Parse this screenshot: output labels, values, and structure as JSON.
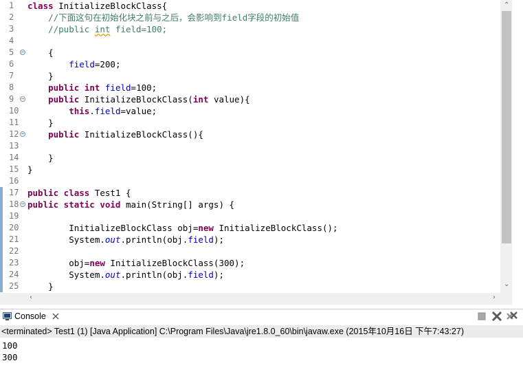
{
  "editor": {
    "lines": [
      {
        "n": "1",
        "code": [
          [
            "kw",
            "class "
          ],
          [
            "pl",
            "InitializeBlockClass{"
          ]
        ]
      },
      {
        "n": "2",
        "code": [
          [
            "pl",
            "    "
          ],
          [
            "cm",
            "//下面这句在初始化块之前与之后，会影响到field字段的初始值"
          ]
        ]
      },
      {
        "n": "3",
        "code": [
          [
            "pl",
            "    "
          ],
          [
            "cm",
            "//public "
          ],
          [
            "cmsq",
            "int"
          ],
          [
            "cm",
            " field=100;"
          ]
        ]
      },
      {
        "n": "4",
        "code": []
      },
      {
        "n": "5",
        "fold": true,
        "code": [
          [
            "pl",
            "    {"
          ]
        ]
      },
      {
        "n": "6",
        "code": [
          [
            "pl",
            "        "
          ],
          [
            "fd",
            "field"
          ],
          [
            "pl",
            "=200;"
          ]
        ]
      },
      {
        "n": "7",
        "code": [
          [
            "pl",
            "    }"
          ]
        ]
      },
      {
        "n": "8",
        "code": [
          [
            "pl",
            "    "
          ],
          [
            "kw",
            "public int "
          ],
          [
            "fd",
            "field"
          ],
          [
            "pl",
            "=100;"
          ]
        ]
      },
      {
        "n": "9",
        "fold": true,
        "code": [
          [
            "pl",
            "    "
          ],
          [
            "kw",
            "public "
          ],
          [
            "pl",
            "InitializeBlockClass("
          ],
          [
            "kw",
            "int "
          ],
          [
            "pl",
            "value){"
          ]
        ]
      },
      {
        "n": "10",
        "code": [
          [
            "pl",
            "        "
          ],
          [
            "kw",
            "this"
          ],
          [
            "pl",
            "."
          ],
          [
            "fd",
            "field"
          ],
          [
            "pl",
            "=value;"
          ]
        ]
      },
      {
        "n": "11",
        "code": [
          [
            "pl",
            "    }"
          ]
        ]
      },
      {
        "n": "12",
        "fold": true,
        "code": [
          [
            "pl",
            "    "
          ],
          [
            "kw",
            "public "
          ],
          [
            "pl",
            "InitializeBlockClass(){"
          ]
        ]
      },
      {
        "n": "13",
        "code": []
      },
      {
        "n": "14",
        "code": [
          [
            "pl",
            "    }"
          ]
        ]
      },
      {
        "n": "15",
        "code": [
          [
            "pl",
            "}"
          ]
        ]
      },
      {
        "n": "16",
        "code": []
      },
      {
        "n": "17",
        "marker": true,
        "code": [
          [
            "kw",
            "public class "
          ],
          [
            "pl",
            "Test1 {"
          ]
        ]
      },
      {
        "n": "18",
        "marker": true,
        "fold": true,
        "code": [
          [
            "kw",
            "public static void "
          ],
          [
            "pl",
            "main(String[] args) {"
          ]
        ]
      },
      {
        "n": "19",
        "marker": true,
        "code": []
      },
      {
        "n": "20",
        "marker": true,
        "code": [
          [
            "pl",
            "        InitializeBlockClass obj="
          ],
          [
            "kw",
            "new "
          ],
          [
            "pl",
            "InitializeBlockClass();"
          ]
        ]
      },
      {
        "n": "21",
        "marker": true,
        "code": [
          [
            "pl",
            "        System."
          ],
          [
            "st",
            "out"
          ],
          [
            "pl",
            ".println(obj."
          ],
          [
            "fd",
            "field"
          ],
          [
            "pl",
            ");"
          ]
        ]
      },
      {
        "n": "22",
        "marker": true,
        "code": []
      },
      {
        "n": "23",
        "marker": true,
        "code": [
          [
            "pl",
            "        obj="
          ],
          [
            "kw",
            "new "
          ],
          [
            "pl",
            "InitializeBlockClass(300);"
          ]
        ]
      },
      {
        "n": "24",
        "marker": true,
        "code": [
          [
            "pl",
            "        System."
          ],
          [
            "st",
            "out"
          ],
          [
            "pl",
            ".println(obj."
          ],
          [
            "fd",
            "field"
          ],
          [
            "pl",
            ");"
          ]
        ]
      },
      {
        "n": "25",
        "marker": true,
        "code": [
          [
            "pl",
            "    }"
          ]
        ]
      }
    ]
  },
  "console": {
    "tab_label": "Console",
    "status": "<terminated> Test1 (1) [Java Application] C:\\Program Files\\Java\\jre1.8.0_60\\bin\\javaw.exe (2015年10月16日 下午7:43:27)",
    "output": [
      "100",
      "300"
    ]
  },
  "icons": {
    "console_icon": "console-monitor",
    "close_tab_icon": "close-x",
    "stop_icon": "terminate-square",
    "remove_icon": "remove-x",
    "remove_all_icon": "remove-all-x"
  },
  "colors": {
    "keyword": "#7f0055",
    "comment": "#3f7f5f",
    "field": "#0000c0"
  }
}
